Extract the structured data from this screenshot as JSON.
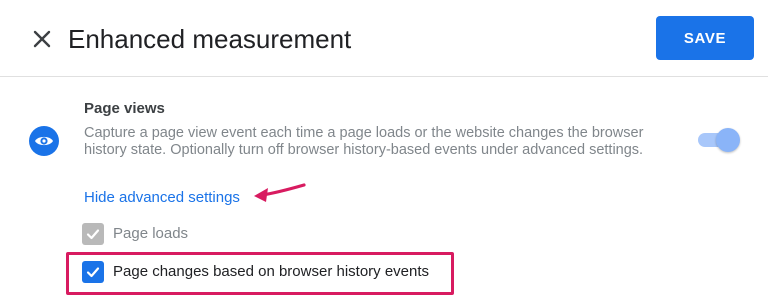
{
  "header": {
    "title": "Enhanced measurement",
    "save_label": "SAVE",
    "close_icon": "close-icon"
  },
  "section": {
    "icon": "eye-icon",
    "title": "Page views",
    "description": "Capture a page view event each time a page loads or the website changes the browser history state. Optionally turn off browser history-based events under advanced settings.",
    "toggle_on": true,
    "advanced_link": "Hide advanced settings"
  },
  "options": {
    "page_loads": {
      "label": "Page loads",
      "checked": true,
      "disabled": true
    },
    "history_changes": {
      "label": "Page changes based on browser history events",
      "checked": true,
      "disabled": false
    }
  },
  "annotations": {
    "arrow_color": "#d81b60",
    "highlight_color": "#d81b60"
  },
  "colors": {
    "accent": "#1a73e8",
    "toggle_track": "#a8c7fa",
    "toggle_knob": "#8ab4f8"
  }
}
